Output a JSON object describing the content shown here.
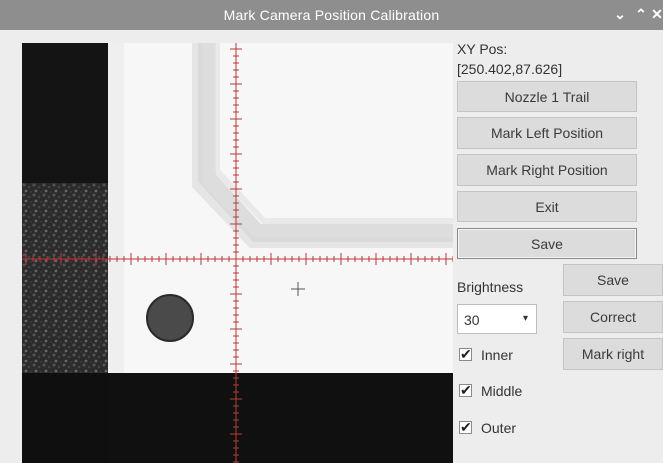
{
  "window": {
    "title": "Mark Camera Position Calibration",
    "controls": [
      "⌄",
      "⌃",
      "✕"
    ]
  },
  "position": {
    "label": "XY Pos:",
    "value": "[250.402,87.626]"
  },
  "buttons": {
    "nozzle_trail": "Nozzle 1 Trail",
    "mark_left": "Mark Left Position",
    "mark_right": "Mark Right Position",
    "exit": "Exit",
    "save_main": "Save",
    "save_small": "Save",
    "correct": "Correct",
    "mark_right_small": "Mark right"
  },
  "brightness": {
    "label": "Brightness",
    "value": "30"
  },
  "checks": [
    {
      "label": "Inner",
      "checked": true
    },
    {
      "label": "Middle",
      "checked": true
    },
    {
      "label": "Outer",
      "checked": true
    }
  ],
  "colors": {
    "titlebar": "#8e8e8e",
    "panel": "#ededed",
    "button": "#dcdcdc",
    "crosshair": "#b83a3a"
  }
}
